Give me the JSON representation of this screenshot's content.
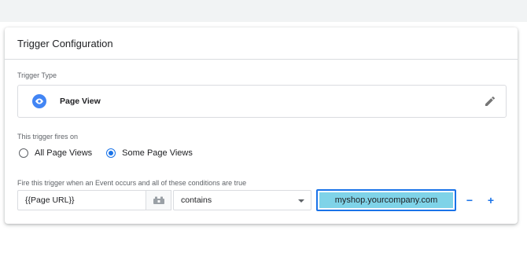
{
  "card": {
    "title": "Trigger Configuration"
  },
  "trigger_type": {
    "label": "Trigger Type",
    "name": "Page View"
  },
  "fires_on": {
    "label": "This trigger fires on",
    "options": [
      "All Page Views",
      "Some Page Views"
    ],
    "selected": "Some Page Views"
  },
  "condition": {
    "label": "Fire this trigger when an Event occurs and all of these conditions are true",
    "variable": "{{Page URL}}",
    "operator": "contains",
    "value": "myshop.yourcompany.com",
    "remove_label": "−",
    "add_label": "+"
  },
  "colors": {
    "accent": "#1a73e8",
    "icon_blue": "#4285f4",
    "selection": "#7fd3e8"
  }
}
